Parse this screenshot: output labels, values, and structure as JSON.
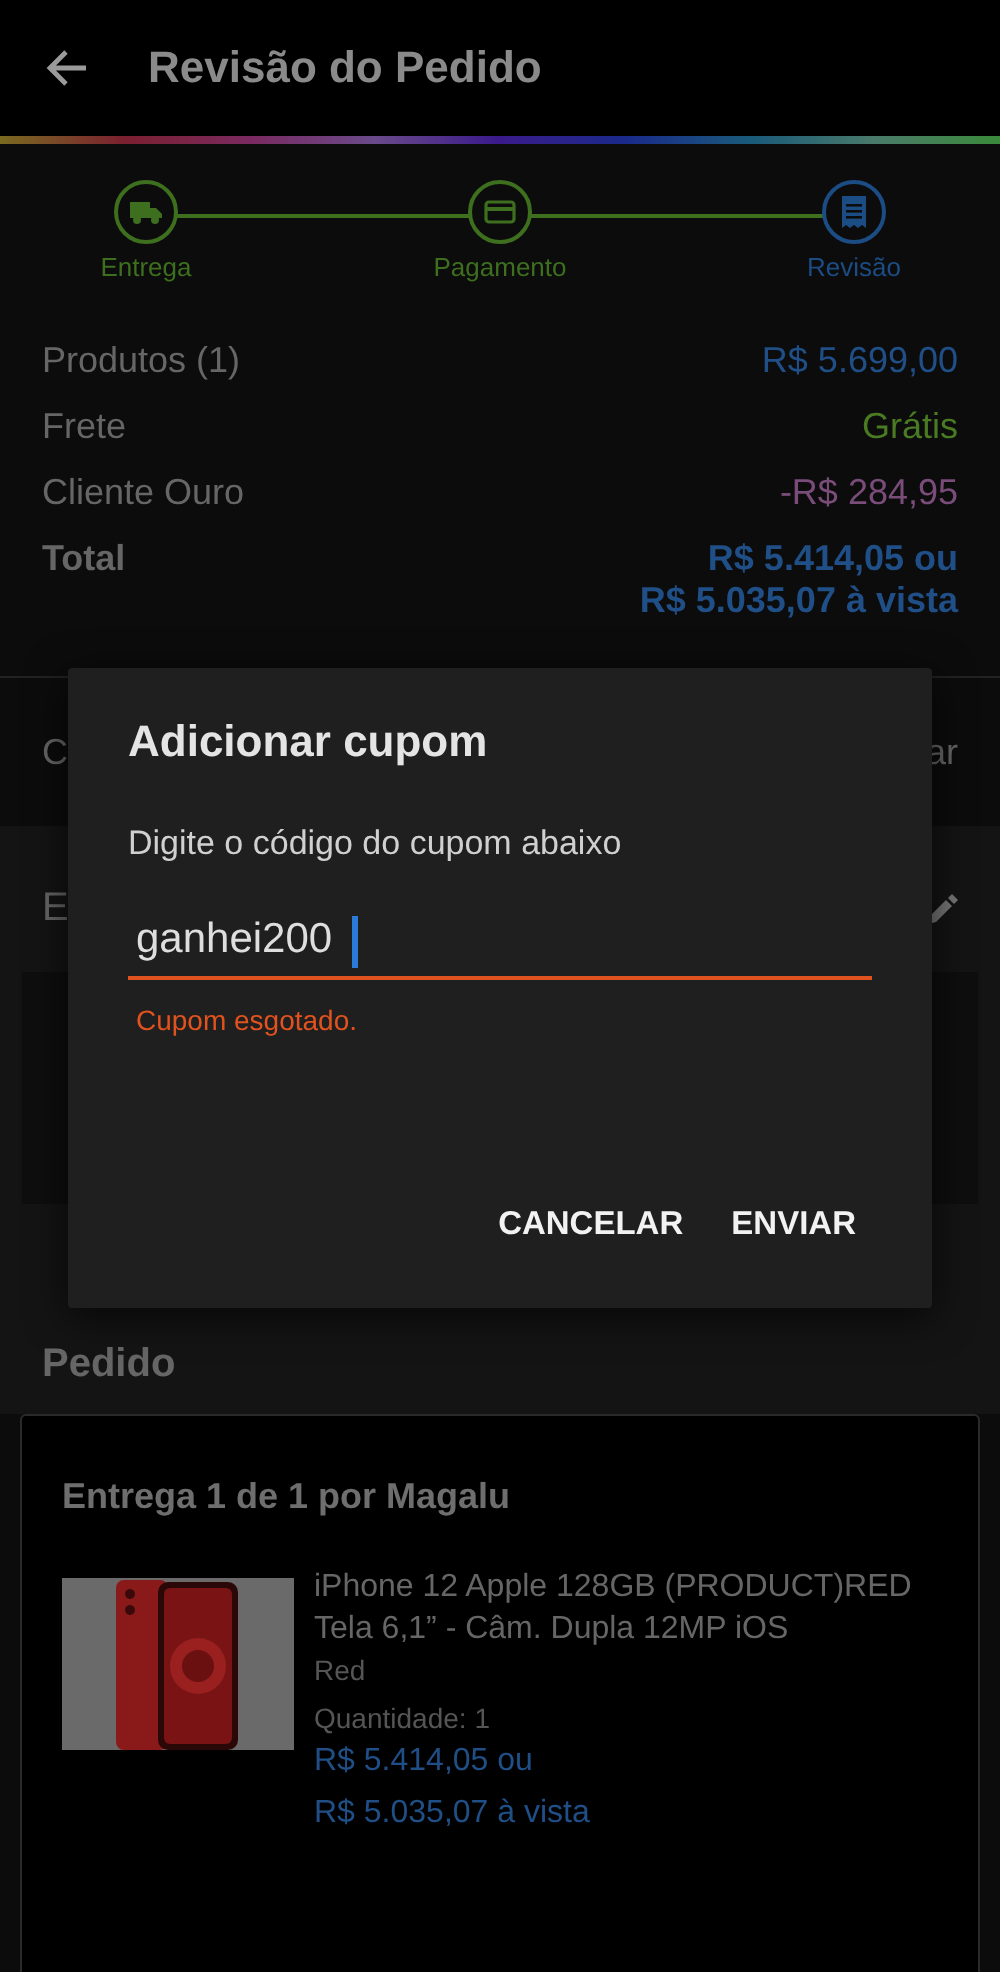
{
  "header": {
    "title": "Revisão do Pedido"
  },
  "steps": [
    {
      "label": "Entrega",
      "selected": false
    },
    {
      "label": "Pagamento",
      "selected": false
    },
    {
      "label": "Revisão",
      "selected": true
    }
  ],
  "summary": [
    {
      "label": "Produtos (1)",
      "value": "R$ 5.699,00",
      "kind": "price"
    },
    {
      "label": "Frete",
      "value": "Grátis",
      "kind": "free"
    },
    {
      "label": "Cliente Ouro",
      "value": "-R$ 284,95",
      "kind": "discount"
    },
    {
      "label": "Total",
      "value": "R$ 5.414,05 ou",
      "value_2": "R$ 5.035,07 à vista",
      "kind": "total"
    }
  ],
  "coupon_row": {
    "left": "C",
    "right": "ar"
  },
  "address_section": {
    "title": "E"
  },
  "order": {
    "title": "Pedido",
    "delivery": "Entrega 1 de 1 por Magalu",
    "product": {
      "name": "iPhone 12 Apple 128GB (PRODUCT)RED Tela 6,1” - Câm. Dupla 12MP iOS",
      "variant": "Red",
      "quantity_label": "Quantidade:",
      "quantity": "1",
      "price": "R$ 5.414,05 ou",
      "price_cash": "R$ 5.035,07 à vista"
    }
  },
  "dialog": {
    "title": "Adicionar cupom",
    "message": "Digite o código do cupom abaixo",
    "field": {
      "value": "ganhei200",
      "error": "Cupom esgotado."
    },
    "buttons": [
      "CANCELAR",
      "ENVIAR"
    ]
  }
}
